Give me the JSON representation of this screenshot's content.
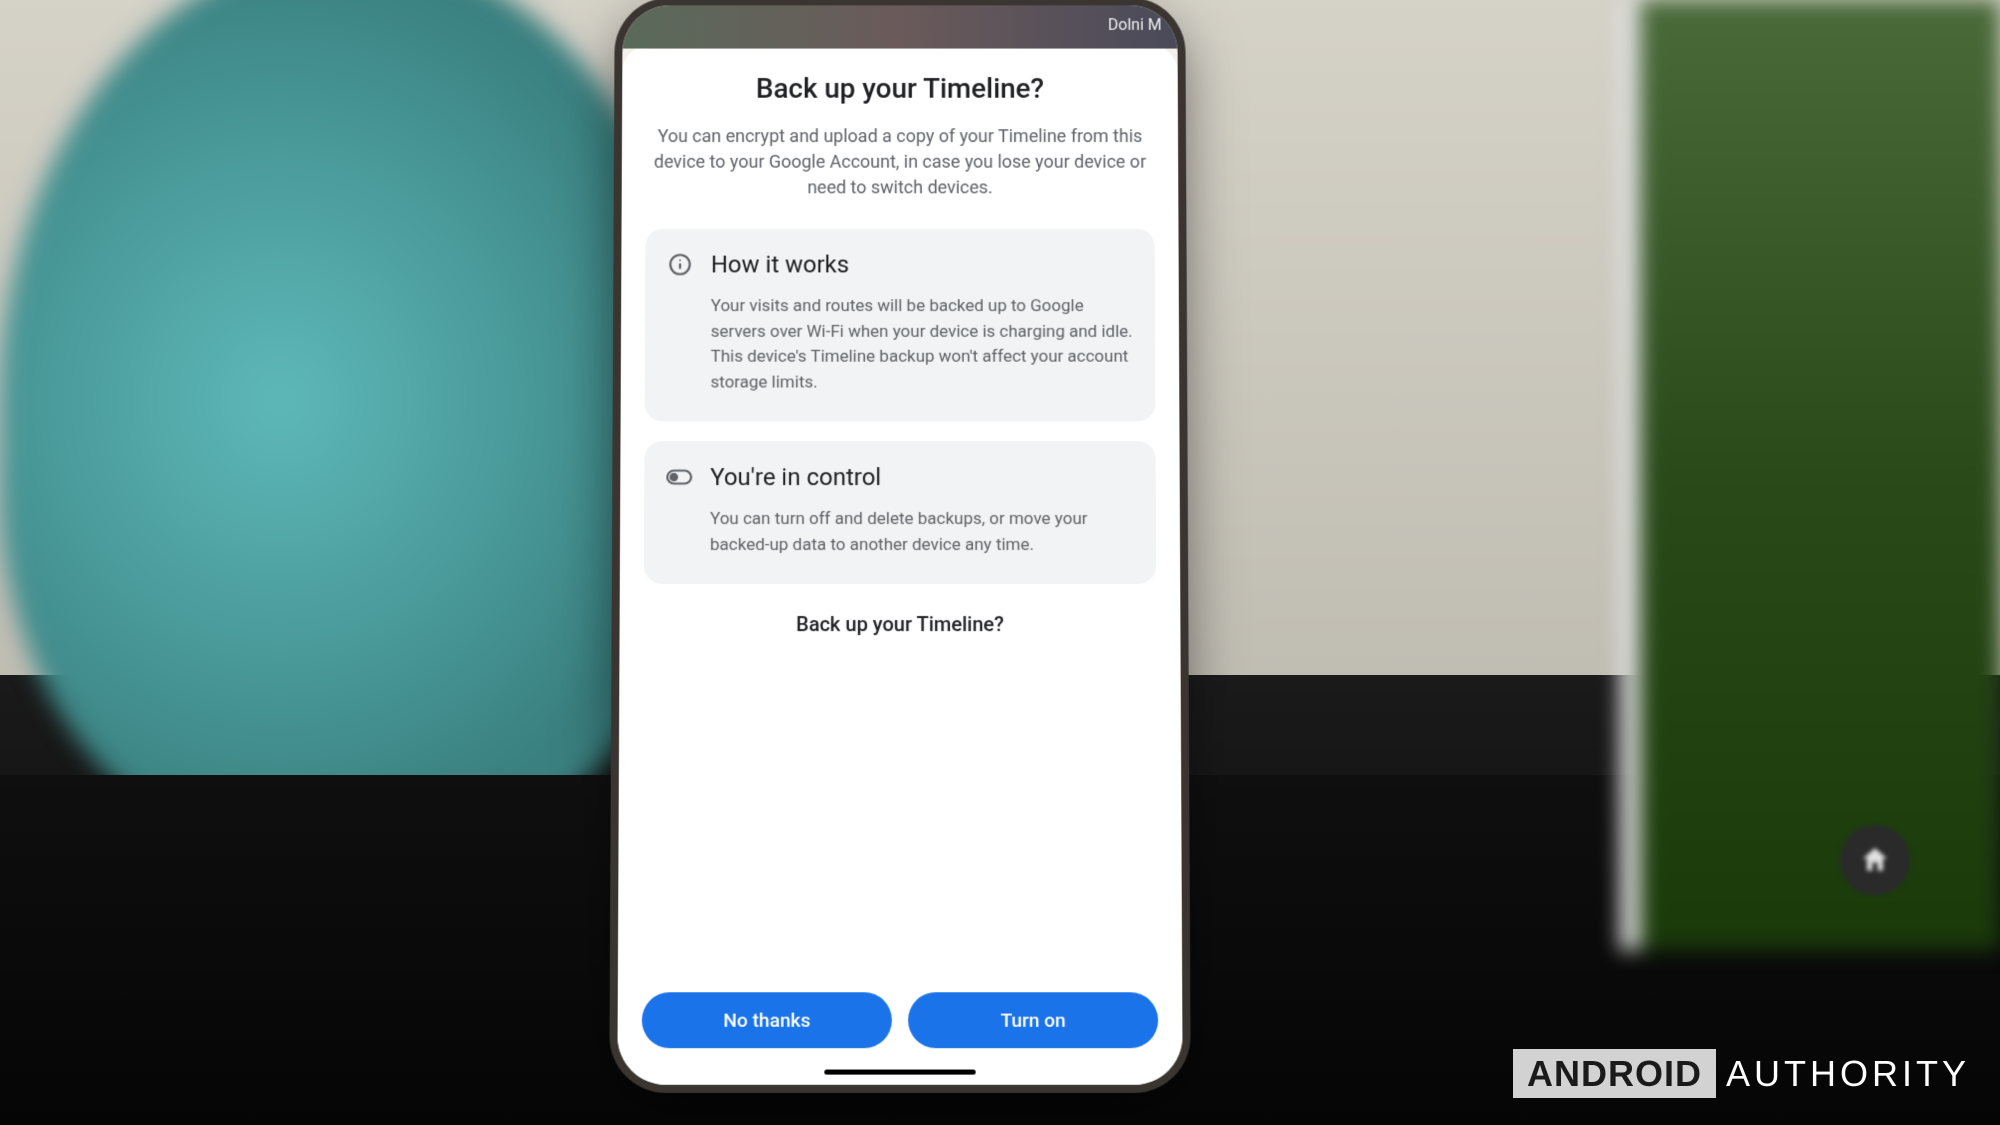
{
  "statusbar": {
    "map_label": "Dolni M"
  },
  "dialog": {
    "title": "Back up your Timeline?",
    "subtitle": "You can encrypt and upload a copy of your Timeline from this device to your Google Account, in case you lose your device or need to switch devices.",
    "cards": [
      {
        "icon": "info",
        "title": "How it works",
        "body": "Your visits and routes will be backed up to Google servers over Wi-Fi when your device is charging and idle. This device's Timeline backup won't affect your account storage limits."
      },
      {
        "icon": "toggle",
        "title": "You're in control",
        "body": "You can turn off and delete backups, or move your backed-up data to another device any time."
      }
    ],
    "confirm": "Back up your Timeline?",
    "buttons": {
      "negative": "No thanks",
      "positive": "Turn on"
    }
  },
  "watermark": {
    "brand": "ANDROID",
    "suffix": "AUTHORITY"
  }
}
